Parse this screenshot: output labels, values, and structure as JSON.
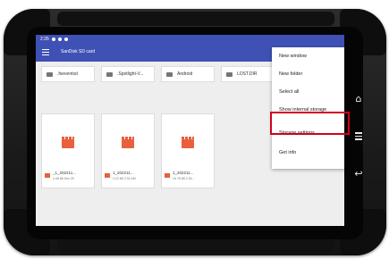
{
  "status_bar": {
    "time": "2:35"
  },
  "toolbar": {
    "title": "SanDisk SD card"
  },
  "folders": [
    {
      "name": ".fseventsd"
    },
    {
      "name": ".Spotlight-V..."
    },
    {
      "name": "Android"
    },
    {
      "name": "LOST.DIR"
    }
  ],
  "files": [
    {
      "name": "_1_202211...",
      "meta": "4.48 kB Dec 20"
    },
    {
      "name": "1_202211...",
      "meta": "2.22 kB 2:31 AM"
    },
    {
      "name": "1_202211...",
      "meta": "16.78 kB 2:34..."
    }
  ],
  "overflow_menu": {
    "items": [
      {
        "label": "New window"
      },
      {
        "label": "New folder"
      },
      {
        "label": "Select all"
      },
      {
        "label": "Show internal storage"
      },
      {
        "label": "Storage settings"
      },
      {
        "label": "Get info"
      }
    ],
    "highlighted": "Storage settings"
  },
  "colors": {
    "toolbar": "#3f51b5",
    "highlight_box": "#d0021b",
    "file_thumbnail": "#e8603c"
  }
}
